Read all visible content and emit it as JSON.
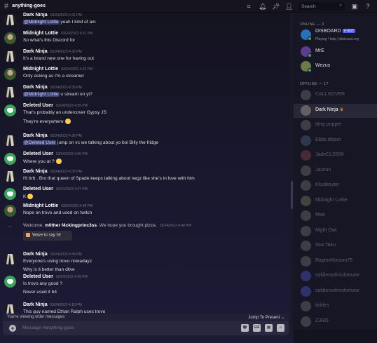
{
  "header": {
    "channel": "anything-goes",
    "search_placeholder": "Search"
  },
  "messages": [
    {
      "author": "Dark Ninja",
      "ts": "03/24/2023 4:31 PM",
      "mention": "@Midnight Lottie",
      "text": " yeah I kind of am",
      "av": "ninja"
    },
    {
      "author": "Midnight Lottie",
      "ts": "03/24/2023 4:31 PM",
      "text": "So what's this Discord for",
      "av": "lottie"
    },
    {
      "author": "Dark Ninja",
      "ts": "03/24/2023 4:32 PM",
      "text": "It's a brand new one for having out",
      "av": "ninja"
    },
    {
      "author": "Midnight Lottie",
      "ts": "03/24/2023 4:32 PM",
      "text": "Only asking as I'm a streamer",
      "av": "lottie"
    },
    {
      "author": "Dark Ninja",
      "ts": "03/24/2023 4:32 PM",
      "mention": "@Midnight Lottie",
      "text": " u stream on yt?",
      "av": "ninja"
    },
    {
      "author": "Deleted User",
      "ts": "03/24/2023 4:35 PM",
      "text": "That's probably an undercover Gypsy JS",
      "text2": "They're everywhere",
      "av": "del"
    },
    {
      "author": "Dark Ninja",
      "ts": "03/24/2023 4:36 PM",
      "mention": "@Deleted User",
      "text": " jump on vc we talking about yo boi Billy the fridge",
      "av": "ninja"
    },
    {
      "author": "Deleted User",
      "ts": "03/24/2023 4:36 PM",
      "text": "Where you at ?",
      "av": "del"
    },
    {
      "author": "Dark Ninja",
      "ts": "03/24/2023 4:37 PM",
      "text": "I'll brb . Bro that queen of Spade keeps talking about negz like she's in love with him",
      "av": "ninja"
    },
    {
      "author": "Deleted User",
      "ts": "03/24/2023 4:47 PM",
      "text": "K",
      "av": "del"
    },
    {
      "author": "Midnight Lottie",
      "ts": "03/24/2023 4:48 PM",
      "text": "Nope on trovo and used on twitch",
      "av": "lottie"
    },
    {
      "author": "Dark Ninja",
      "ts": "03/24/2023 4:49 PM",
      "text": "Everyone's using trovo nowadayz",
      "text2": "Why is it better than dlive",
      "av": "ninja"
    },
    {
      "author": "Deleted User",
      "ts": "03/24/2023 4:49 PM",
      "text": "Is trovo any good ?",
      "text2": "Never used it b4",
      "av": "del"
    },
    {
      "author": "Dark Ninja",
      "ts": "03/24/2023 4:19 PM",
      "text": "This guy named Ethan Ralph uses trovo",
      "av": "ninja"
    }
  ],
  "join": {
    "prefix": "Welcome, ",
    "user": "m0ther f4ckingprinc3ss",
    "suffix": ". We hope you brought pizza.",
    "ts": "03/24/2023 4:48 PM",
    "wave": "Wave to say hi!"
  },
  "older": {
    "text": "You're viewing older messages",
    "jump": "Jump To Present"
  },
  "input": {
    "placeholder": "Message #anything-goes",
    "gif": "GIF"
  },
  "members": {
    "online_header": "ONLINE — 3",
    "offline_header": "OFFLINE — 17",
    "online": [
      {
        "name": "DISBOARD",
        "bot": "✔ BOT",
        "sub": "Playing ! help | disboard.org",
        "color": "#2b6fb8"
      },
      {
        "name": "MrE",
        "color": "#5a3d8c"
      },
      {
        "name": "Wezus",
        "color": "#6b7a48"
      }
    ],
    "offline": [
      {
        "name": "CALLSOVER",
        "color": "#888"
      },
      {
        "name": "Dark Ninja",
        "color": "#cfc9b8",
        "sel": true
      },
      {
        "name": "derp pupper",
        "color": "#888"
      },
      {
        "name": "Ebbs.dkpist",
        "color": "#5a7a9a"
      },
      {
        "name": "JadeCLS550",
        "color": "#a05050"
      },
      {
        "name": "Jazmin",
        "color": "#888"
      },
      {
        "name": "Klusikeyter",
        "color": "#888"
      },
      {
        "name": "Midnight Lottie",
        "color": "#8a9a6a"
      },
      {
        "name": "Moe",
        "color": "#888"
      },
      {
        "name": "Night Owl",
        "color": "#888"
      },
      {
        "name": "Nux Taku",
        "color": "#888"
      },
      {
        "name": "RaptorHorizon76",
        "color": "#888"
      },
      {
        "name": "soldiersofmisfortune",
        "color": "#5865f2"
      },
      {
        "name": "soldiersofmisfortune",
        "color": "#5865f2"
      },
      {
        "name": "tickles",
        "color": "#888"
      },
      {
        "name": "Z3RO",
        "color": "#888"
      }
    ]
  }
}
